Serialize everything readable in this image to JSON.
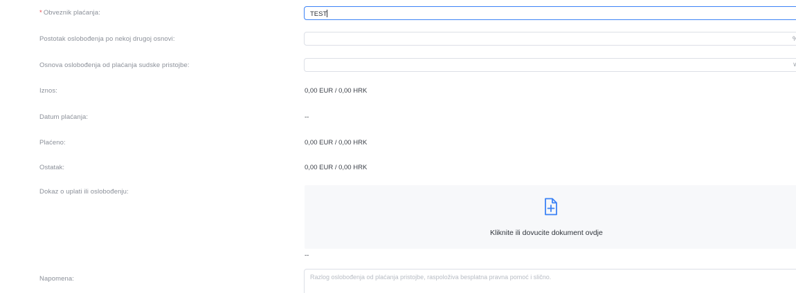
{
  "form": {
    "payer": {
      "required_mark": "*",
      "label": "Obveznik plaćanja:",
      "value": "TEST"
    },
    "exemption_percent": {
      "label": "Postotak oslobođenja po nekoj drugoj osnovi:",
      "value": "",
      "suffix": "%"
    },
    "exemption_basis": {
      "label": "Osnova oslobođenja od plaćanja sudske pristojbe:",
      "value": "",
      "arrow": "∨"
    },
    "amount": {
      "label": "Iznos:",
      "value": "0,00 EUR / 0,00 HRK"
    },
    "payment_date": {
      "label": "Datum plaćanja:",
      "value": "--"
    },
    "paid": {
      "label": "Plaćeno:",
      "value": "0,00 EUR / 0,00 HRK"
    },
    "remaining": {
      "label": "Ostatak:",
      "value": "0,00 EUR / 0,00 HRK"
    },
    "proof": {
      "label": "Dokaz o uplati ili oslobođenju:",
      "dropzone_text": "Kliknite ili dovucite dokument ovdje",
      "icon": "file-add-icon",
      "files_value": "--"
    },
    "note": {
      "label": "Napomena:",
      "placeholder": "Razlog oslobođenja od plaćanja pristojbe, raspoloživa besplatna pravna pomoć i slično."
    }
  },
  "colors": {
    "accent": "#3b82f6",
    "required": "#e5484d",
    "label": "#8a8f98",
    "dropzone_bg": "#f7f8fa"
  }
}
